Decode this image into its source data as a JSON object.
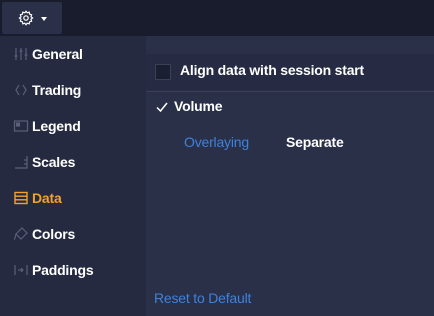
{
  "toolbar": {
    "settings_icon": "gear-icon",
    "dropdown_icon": "caret-down-icon"
  },
  "sidebar": {
    "items": [
      {
        "label": "General",
        "icon": "sliders-icon",
        "active": false
      },
      {
        "label": "Trading",
        "icon": "trading-icon",
        "active": false
      },
      {
        "label": "Legend",
        "icon": "legend-icon",
        "active": false
      },
      {
        "label": "Scales",
        "icon": "scales-icon",
        "active": false
      },
      {
        "label": "Data",
        "icon": "data-icon",
        "active": true
      },
      {
        "label": "Colors",
        "icon": "colors-icon",
        "active": false
      },
      {
        "label": "Paddings",
        "icon": "paddings-icon",
        "active": false
      }
    ]
  },
  "data_panel": {
    "align_session": {
      "label": "Align data with session start",
      "checked": false
    },
    "volume": {
      "label": "Volume",
      "checked": true
    },
    "volume_modes": {
      "options": [
        "Overlaying",
        "Separate"
      ],
      "selected": "Separate"
    },
    "reset_label": "Reset to Default"
  },
  "colors": {
    "accent_active": "#f5a02c",
    "link": "#3d82dc",
    "text": "#ffffff",
    "icon_muted": "#5a6079"
  }
}
